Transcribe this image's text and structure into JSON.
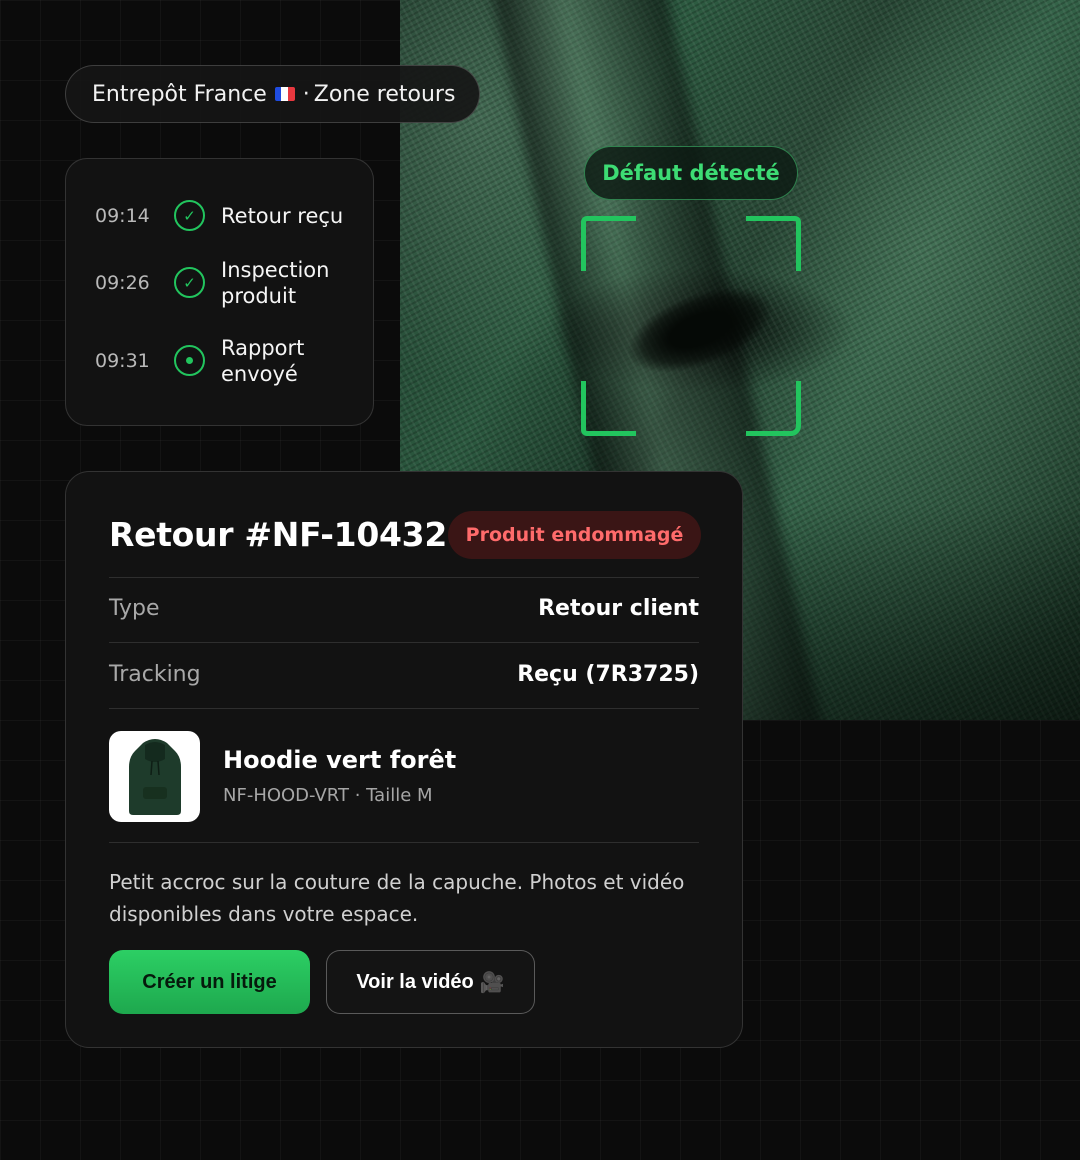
{
  "location": {
    "warehouse": "Entrepôt France",
    "separator": "·",
    "zone": "Zone retours"
  },
  "timeline": [
    {
      "time": "09:14",
      "label": "Retour reçu",
      "status": "done"
    },
    {
      "time": "09:26",
      "label": "Inspection produit",
      "status": "done"
    },
    {
      "time": "09:31",
      "label": "Rapport envoyé",
      "status": "current"
    }
  ],
  "detection": {
    "label": "Défaut détecté",
    "color": "#22c55e"
  },
  "card": {
    "title": "Retour #NF-10432",
    "status": "Produit endommagé",
    "fields": [
      {
        "label": "Type",
        "value": "Retour client"
      },
      {
        "label": "Tracking",
        "value": "Reçu (7R3725)"
      }
    ],
    "product": {
      "name": "Hoodie vert forêt",
      "sku": "NF-HOOD-VRT · Taille M"
    },
    "description": "Petit accroc sur la couture de la capuche. Photos et vidéo disponibles dans votre espace.",
    "primary_action": "Créer un litige",
    "secondary_action": "Voir la vidéo",
    "secondary_action_icon": "🎥"
  },
  "colors": {
    "accent": "#22c55e",
    "danger": "#ff6b6b",
    "danger_bg": "#3a1515"
  }
}
